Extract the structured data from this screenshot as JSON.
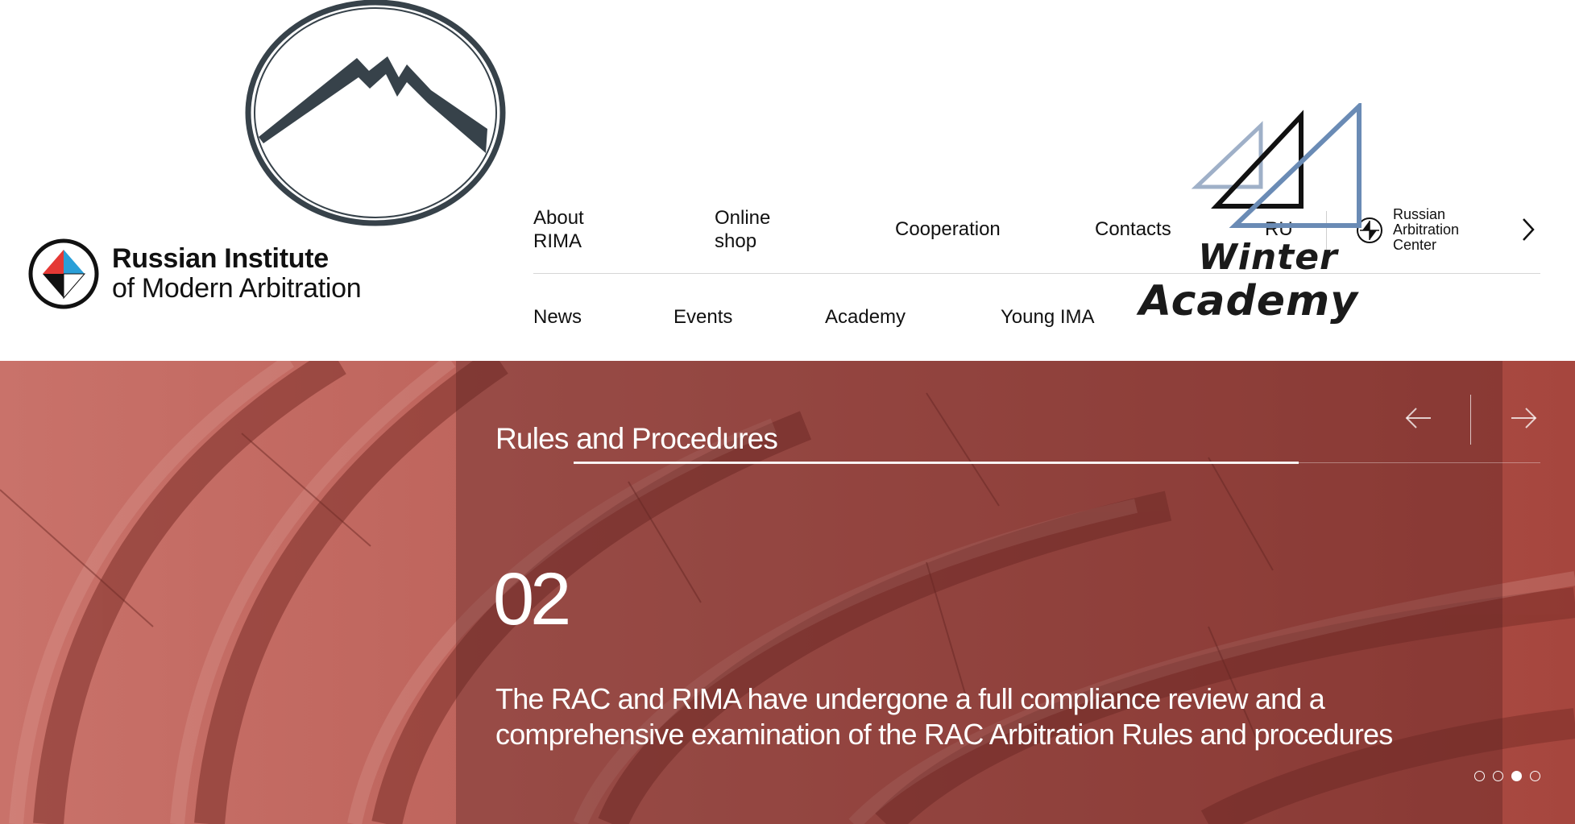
{
  "brand": {
    "name_line1": "Russian Institute",
    "name_line2": "of Modern Arbitration"
  },
  "nav_top": [
    {
      "line1": "About",
      "line2": "RIMA"
    },
    {
      "line1": "Online",
      "line2": "shop"
    },
    {
      "line1": "Cooperation",
      "line2": ""
    },
    {
      "line1": "Contacts",
      "line2": ""
    },
    {
      "line1": "RU",
      "line2": ""
    }
  ],
  "rac_link": {
    "line1": "Russian",
    "line2": "Arbitration",
    "line3": "Center"
  },
  "nav_bottom": [
    {
      "label": "News"
    },
    {
      "label": "Events"
    },
    {
      "label": "Academy"
    },
    {
      "label": "Young IMA"
    }
  ],
  "winter_academy": {
    "line1": "Winter",
    "line2": "Academy"
  },
  "hero": {
    "heading": "Rules and Procedures",
    "slide_number": "02",
    "slide_text": "The RAC and RIMA have undergone a full compliance review and a comprehensive examination of the RAC Arbitration Rules and procedures",
    "slides_total": 4,
    "active_slide": 3,
    "progress_fraction": 0.75
  },
  "colors": {
    "hero_red": "#a6463e",
    "brand_red": "#e53935",
    "brand_blue": "#2a9fd8",
    "logo_dark": "#37424a",
    "winter_blue": "#6a8bb5"
  },
  "icons": {
    "prev": "arrow-left-icon",
    "next": "arrow-right-icon",
    "nav_more": "chevron-right-icon",
    "rac": "rac-logo-icon"
  }
}
